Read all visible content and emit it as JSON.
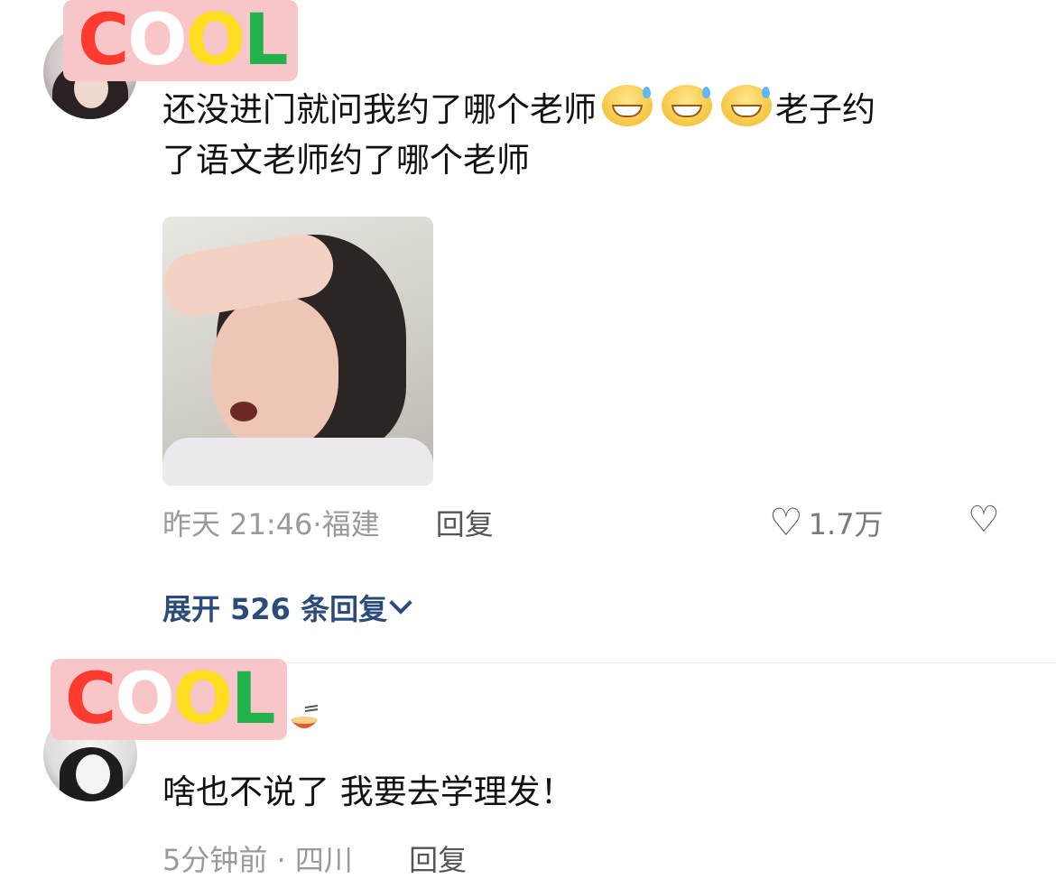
{
  "comments": [
    {
      "badge_letters": [
        "C",
        "O",
        "O",
        "L"
      ],
      "text_line1_a": "还没进门就问我约了哪个老师",
      "text_line1_b": "老子约",
      "text_line2": "了语文老师约了哪个老师",
      "emoji_icon": "grinning-sweat-emoji",
      "emoji_count": 3,
      "time": "昨天 21:46",
      "location": "福建",
      "reply_label": "回复",
      "likes": "1.7万",
      "expand_label": "展开 526 条回复"
    },
    {
      "badge_letters": [
        "C",
        "O",
        "O",
        "L"
      ],
      "badge_decor_icon": "noodle-bowl-icon",
      "text": "啥也不说了 我要去学理发！",
      "time": "5分钟前",
      "location": "四川",
      "reply_label": "回复"
    }
  ],
  "colors": {
    "badge_bg": "#f8c6c9",
    "badge_C": "#ff3b2f",
    "badge_O1": "#ffffff",
    "badge_O2": "#ffde21",
    "badge_L": "#22b24c",
    "expand_link": "#2b4b7a"
  }
}
